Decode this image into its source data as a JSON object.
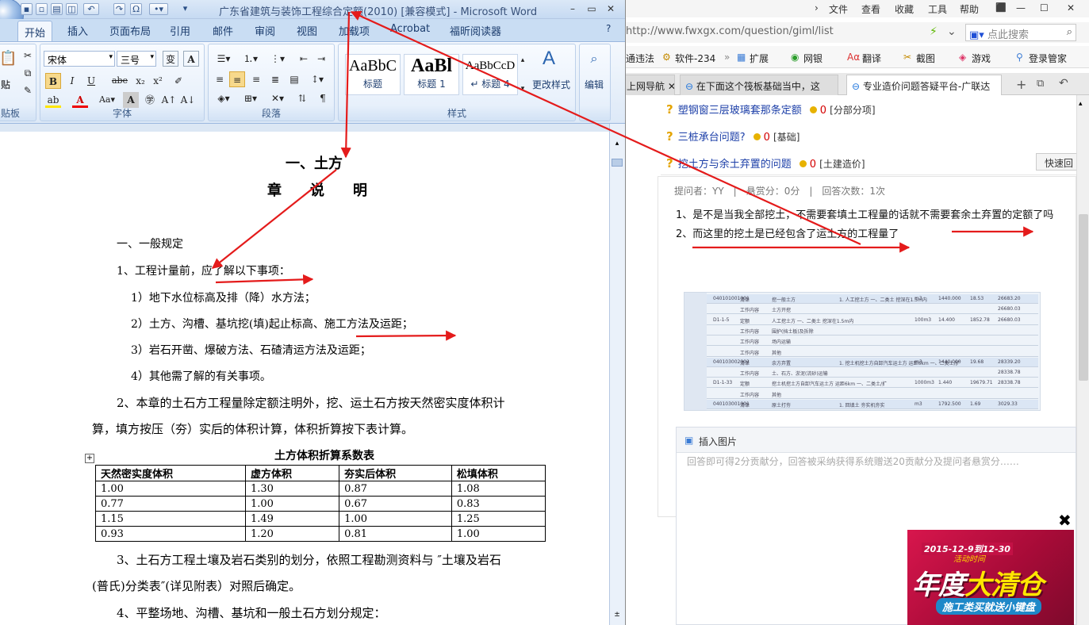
{
  "word": {
    "title": "广东省建筑与装饰工程综合定额(2010) [兼容模式] - Microsoft Word",
    "tabs": [
      "开始",
      "插入",
      "页面布局",
      "引用",
      "邮件",
      "审阅",
      "视图",
      "加载项",
      "Acrobat",
      "福昕阅读器"
    ],
    "font_name": "宋体",
    "font_size": "三号",
    "paste_label": "贴",
    "groups": {
      "clipboard": "贴板",
      "font": "字体",
      "paragraph": "段落",
      "styles": "样式"
    },
    "styles": [
      {
        "preview": "AaBbC",
        "name": "标题"
      },
      {
        "preview": "AaBl",
        "name": "标题 1"
      },
      {
        "preview": "AaBbCcD",
        "name": "↵ 标题 4"
      }
    ],
    "change_styles": "更改样式",
    "editing": "编辑",
    "doc": {
      "heading": "一、土方",
      "subheading": "章　　说　　明",
      "p_general": "一、一般规定",
      "p1": "1、工程计量前，应了解以下事项：",
      "p1_1": "1）地下水位标高及排（降）水方法；",
      "p1_2": "2）土方、沟槽、基坑挖(填)起止标高、施工方法及运距；",
      "p1_3": "3）岩石开凿、爆破方法、石碴清运方法及运距；",
      "p1_4": "4）其他需了解的有关事项。",
      "p2a": "2、本章的土石方工程量除定额注明外，挖、运土石方按天然密实度体积计",
      "p2b": "算，填方按压（夯）实后的体积计算，体积折算按下表计算。",
      "table_title": "土方体积折算系数表",
      "table": [
        [
          "天然密实度体积",
          "虚方体积",
          "夯实后体积",
          "松填体积"
        ],
        [
          "1.00",
          "1.30",
          "0.87",
          "1.08"
        ],
        [
          "0.77",
          "1.00",
          "0.67",
          "0.83"
        ],
        [
          "1.15",
          "1.49",
          "1.00",
          "1.25"
        ],
        [
          "0.93",
          "1.20",
          "0.81",
          "1.00"
        ]
      ],
      "p3a": "3、土石方工程土壤及岩石类别的划分，依照工程勘测资料与 ″土壤及岩石",
      "p3b": "(普氏)分类表″(详见附表）对照后确定。",
      "p4": "4、平整场地、沟槽、基坑和一般土石方划分规定："
    }
  },
  "browser": {
    "menu": [
      "文件",
      "查看",
      "收藏",
      "工具",
      "帮助"
    ],
    "url": "http://www.fwxgx.com/question/giml/list",
    "search_placeholder": "点此搜索",
    "favorites": [
      "通违法",
      "软件-234",
      "扩展",
      "网银",
      "翻译",
      "截图",
      "游戏",
      "登录管家"
    ],
    "tabs": [
      "上网导航",
      "在下面这个筏板基础当中，这",
      "专业造价问题答疑平台-广联达"
    ],
    "questions": [
      {
        "title": "塑钢窗三层玻璃套那条定额",
        "points": "0",
        "category": "[分部分项]"
      },
      {
        "title": "三桩承台问题?",
        "points": "0",
        "category": "[基础]"
      },
      {
        "title": "挖土方与余土弃置的问题",
        "points": "0",
        "category": "[土建造价]"
      }
    ],
    "quick_reply": "快速回",
    "meta": "提问者：YY　|　悬赏分：0分　|　回答次数：1次",
    "q_line1": "1、是不是当我全部挖土，不需要套填土工程量的话就不需要套余土弃置的定额了吗",
    "q_line2": "2、而这里的挖土是已经包含了运土方的工程量了",
    "insert_image": "插入图片",
    "answer_placeholder": "回答即可得2分贡献分，回答被采纳获得系统赠送20贡献分及提问者悬赏分……",
    "ad": {
      "date": "2015-12-9到12-30",
      "sub": "活动时间",
      "big1": "年度",
      "big2": "大清仓",
      "pill": "施工类买就送小键盘"
    },
    "thumb_rows": [
      [
        "040101001001",
        "清单",
        "挖一般土方",
        "1. 人工挖土方 一、二类土 挖深在1.5m内",
        "m3",
        "1440.000",
        "18.53",
        "26683.20"
      ],
      [
        "",
        "工作内容",
        "土方开挖",
        "",
        "",
        "",
        "",
        "26680.03"
      ],
      [
        "D1-1-5",
        "定额",
        "人工挖土方 一、二类土 挖深在1.5m内",
        "",
        "100m3",
        "14.400",
        "1852.78",
        "26680.03"
      ],
      [
        "",
        "工作内容",
        "围护(挡土板)及拆除",
        "",
        "",
        "",
        "",
        ""
      ],
      [
        "",
        "工作内容",
        "场内运输",
        "",
        "",
        "",
        "",
        ""
      ],
      [
        "",
        "工作内容",
        "其他",
        "",
        "",
        "",
        "",
        ""
      ],
      [
        "040103002002",
        "清单",
        "余方弃置",
        "1. 挖土机挖土方自卸汽车运土方 运距6km 一、二类土/扩",
        "m3",
        "1440.000",
        "19.68",
        "28339.20"
      ],
      [
        "",
        "工作内容",
        "土、石方、淤泥(流砂)运输",
        "",
        "",
        "",
        "",
        "28338.78"
      ],
      [
        "D1-1-33",
        "定额",
        "挖土机挖土方自卸汽车运土方 运距6km 一、二类土/扩",
        "",
        "1000m3",
        "1.440",
        "19679.71",
        "28338.78"
      ],
      [
        "",
        "工作内容",
        "其他",
        "",
        "",
        "",
        "",
        ""
      ],
      [
        "040103001001",
        "清单",
        "原土打夯",
        "1. 回填土 夯实机夯实",
        "m3",
        "1792.500",
        "1.69",
        "3029.33"
      ]
    ]
  },
  "colors": {
    "arrow": "#e41b1b",
    "ribbon": "#dde9f7",
    "link": "#1c3fa8"
  }
}
